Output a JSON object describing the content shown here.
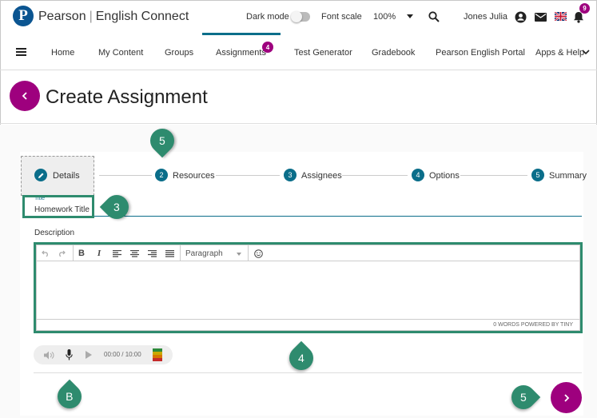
{
  "app": {
    "brand_name": "Pearson",
    "brand_product": "English Connect",
    "logo_letter": "P"
  },
  "topbar": {
    "dark_mode_label": "Dark mode",
    "font_scale_label": "Font scale",
    "font_scale_value": "100%",
    "user_name": "Jones Julia",
    "notifications_count": "9"
  },
  "nav": {
    "items": [
      {
        "label": "Home"
      },
      {
        "label": "My Content"
      },
      {
        "label": "Groups"
      },
      {
        "label": "Assignments",
        "badge": "4"
      },
      {
        "label": "Test Generator"
      },
      {
        "label": "Gradebook"
      },
      {
        "label": "Pearson English Portal"
      },
      {
        "label": "Apps & Help"
      }
    ],
    "active_index": 3
  },
  "page": {
    "title": "Create Assignment"
  },
  "steps": [
    {
      "number": "1",
      "label": "Details"
    },
    {
      "number": "2",
      "label": "Resources"
    },
    {
      "number": "3",
      "label": "Assignees"
    },
    {
      "number": "4",
      "label": "Options"
    },
    {
      "number": "5",
      "label": "Summary"
    }
  ],
  "form": {
    "title_label": "Title",
    "title_value": "Homework Title",
    "description_label": "Description",
    "paragraph_label": "Paragraph",
    "editor_status": "0 WORDS POWERED BY TINY",
    "audio_time": "00:00 / 10:00"
  },
  "markers": {
    "steps": "5",
    "title": "3",
    "editor": "4",
    "audio": "B",
    "next": "5"
  },
  "colors": {
    "primary": "#9e007e",
    "teal": "#0b6e8a",
    "callout": "#2e8b6e"
  }
}
